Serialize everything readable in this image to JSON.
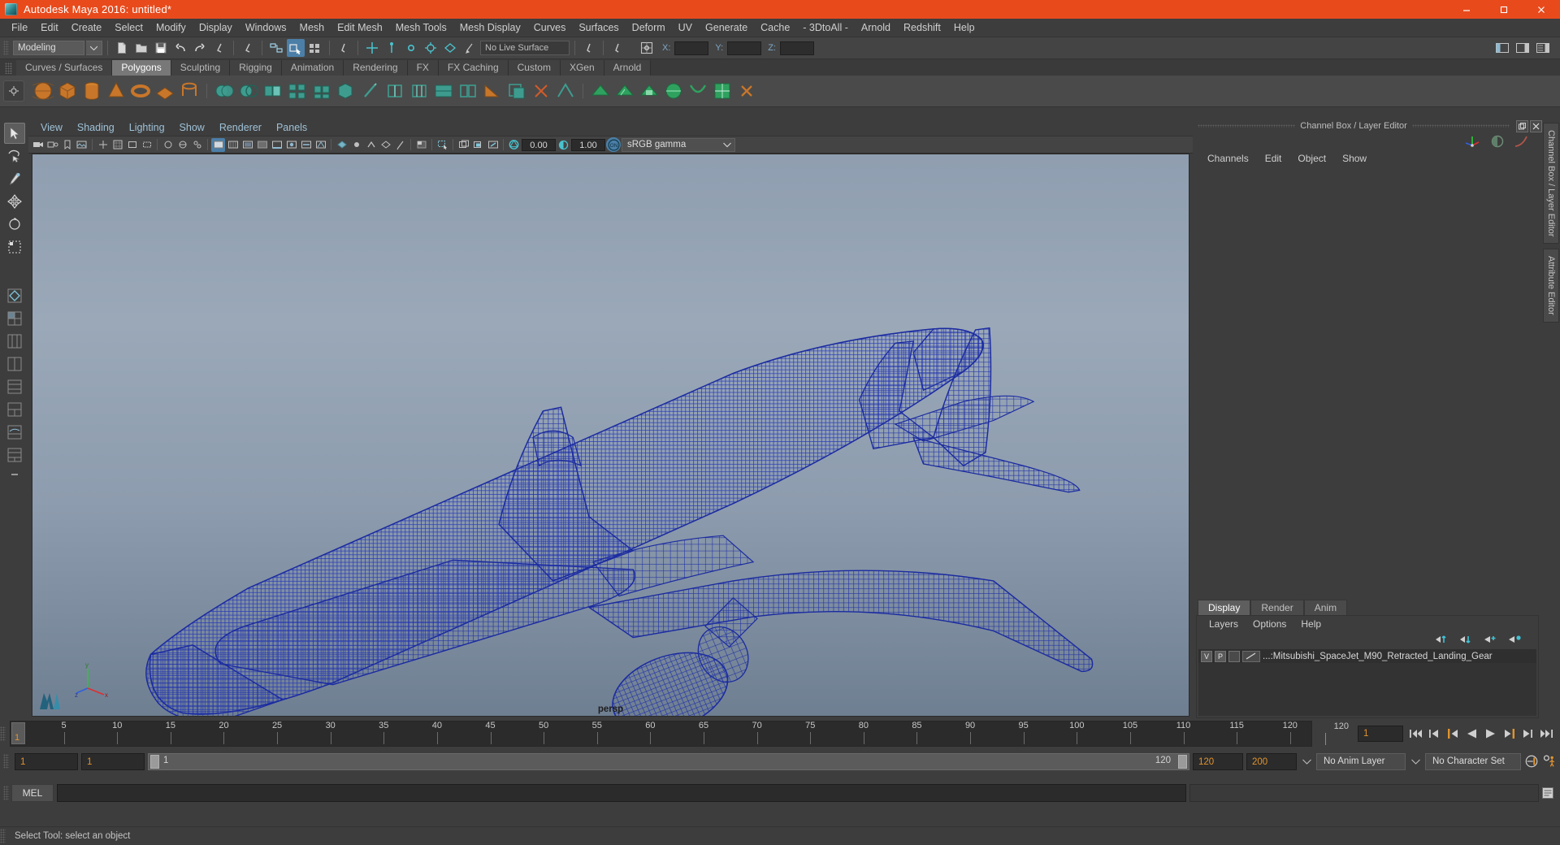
{
  "window": {
    "title": "Autodesk Maya 2016: untitled*",
    "controls": {
      "minimize": "minimize-icon",
      "maximize": "maximize-icon",
      "close": "close-icon"
    }
  },
  "menubar": {
    "items": [
      "File",
      "Edit",
      "Create",
      "Select",
      "Modify",
      "Display",
      "Windows",
      "Mesh",
      "Edit Mesh",
      "Mesh Tools",
      "Mesh Display",
      "Curves",
      "Surfaces",
      "Deform",
      "UV",
      "Generate",
      "Cache",
      "- 3DtoAll -",
      "Arnold",
      "Redshift",
      "Help"
    ]
  },
  "statusbar": {
    "menuset": "Modeling",
    "live_surface": "No Live Surface",
    "x_label": "X:",
    "y_label": "Y:",
    "z_label": "Z:",
    "x_value": "",
    "y_value": "",
    "z_value": ""
  },
  "shelf_tabs": {
    "items": [
      "Curves / Surfaces",
      "Polygons",
      "Sculpting",
      "Rigging",
      "Animation",
      "Rendering",
      "FX",
      "FX Caching",
      "Custom",
      "XGen",
      "Arnold"
    ],
    "selected": "Polygons"
  },
  "viewport": {
    "menus": [
      "View",
      "Shading",
      "Lighting",
      "Show",
      "Renderer",
      "Panels"
    ],
    "exposure": "0.00",
    "gamma_value": "1.00",
    "color_management": "sRGB gamma",
    "camera_label": "persp",
    "axis": {
      "x": "x",
      "y": "y",
      "z": "z"
    },
    "model_name": "Mitsubishi SpaceJet M90 wireframe",
    "wire_color": "#1e2fa8"
  },
  "right_panel": {
    "title": "Channel Box / Layer Editor",
    "channel_menus": [
      "Channels",
      "Edit",
      "Object",
      "Show"
    ],
    "layer_tabs": [
      "Display",
      "Render",
      "Anim"
    ],
    "layer_tab_selected": "Display",
    "layer_editor_menus": [
      "Layers",
      "Options",
      "Help"
    ],
    "layers": [
      {
        "visibility": "V",
        "playback": "P",
        "color": "",
        "name": "...:Mitsubishi_SpaceJet_M90_Retracted_Landing_Gear"
      }
    ],
    "vertical_tabs": [
      "Channel Box / Layer Editor",
      "Attribute Editor"
    ]
  },
  "timeline": {
    "tick_labels": [
      "5",
      "10",
      "15",
      "20",
      "25",
      "30",
      "35",
      "40",
      "45",
      "50",
      "55",
      "60",
      "65",
      "70",
      "75",
      "80",
      "85",
      "90",
      "95",
      "100",
      "105",
      "110",
      "115",
      "120"
    ],
    "current_frame_marker": "1",
    "end_label": "120",
    "current_frame_field": "1",
    "playback_buttons": [
      "go-to-start",
      "step-back-key",
      "step-back-frame",
      "play-backwards",
      "play-forwards",
      "step-forward-frame",
      "step-forward-key",
      "go-to-end"
    ]
  },
  "range": {
    "start_field": "1",
    "range_start_field": "1",
    "slider_start_label": "1",
    "slider_end_label": "120",
    "range_end_field": "120",
    "end_field": "200",
    "anim_layer": "No Anim Layer",
    "character_set": "No Character Set"
  },
  "command_line": {
    "tab_label": "MEL",
    "input_value": "",
    "output_value": ""
  },
  "help_line": {
    "text": "Select Tool: select an object"
  },
  "colors": {
    "title_bar": "#e84a1c",
    "accent_blue": "#4b7fa8",
    "orange_text": "#e0932f",
    "wireframe": "#1e2fa8"
  }
}
